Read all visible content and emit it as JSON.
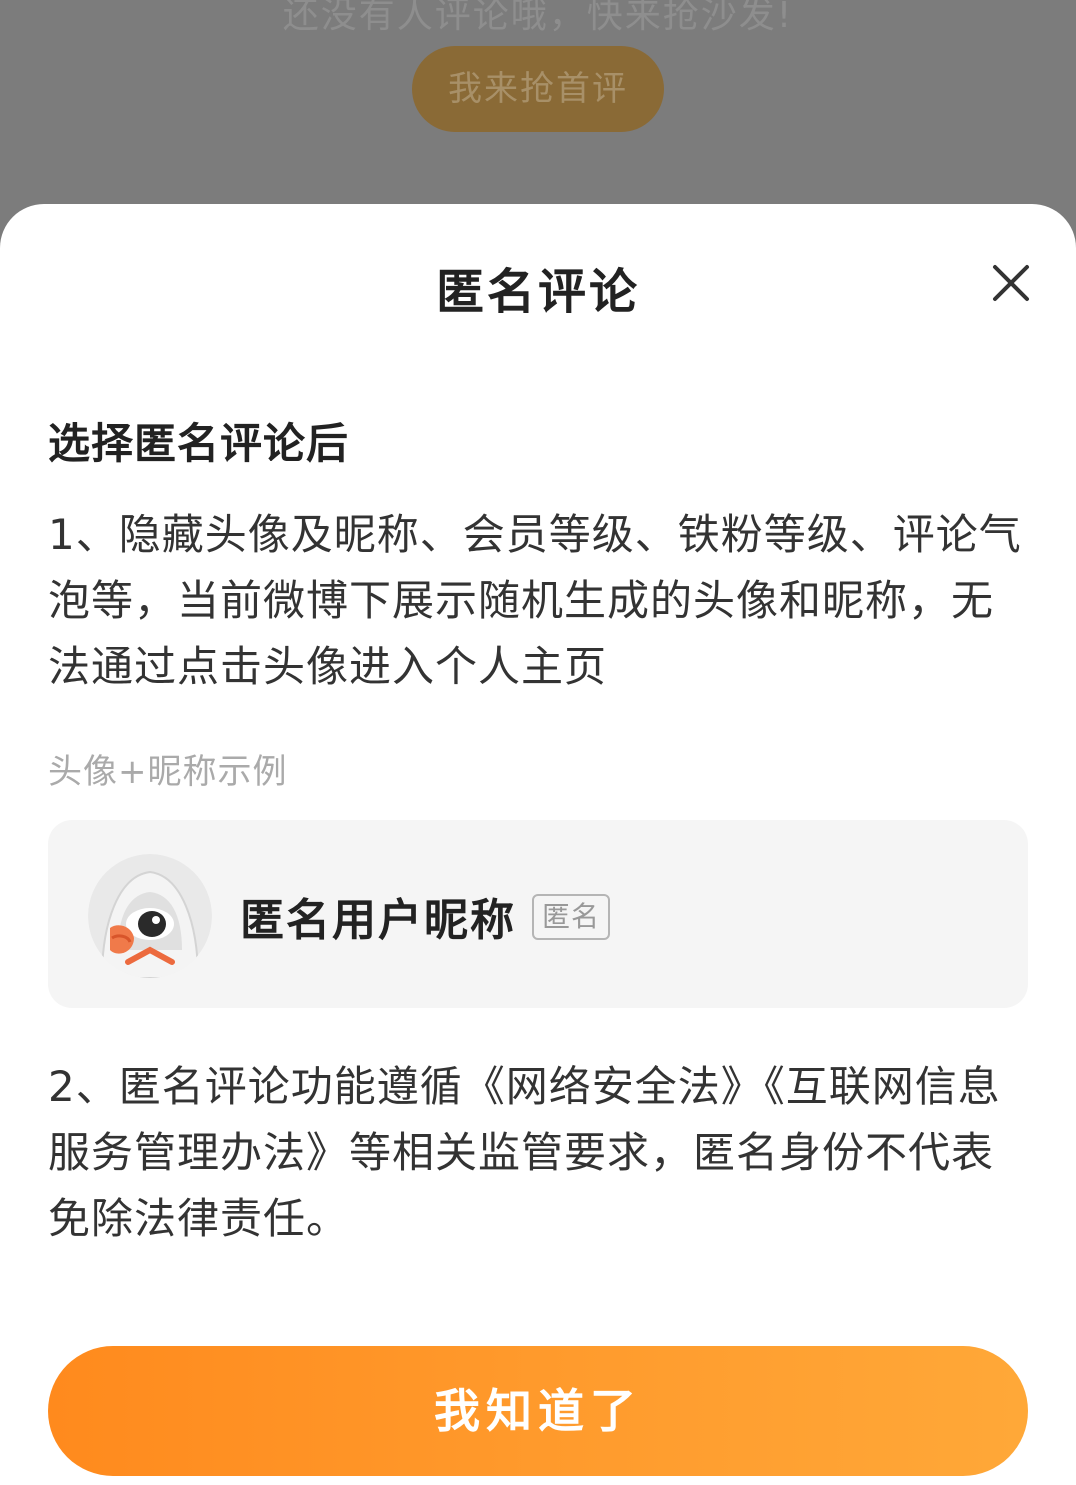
{
  "background": {
    "hint_text": "还没有人评论哦，快来抢沙发!",
    "first_comment_button": "我来抢首评"
  },
  "sheet": {
    "title": "匿名评论",
    "close_icon": "close-icon",
    "heading": "选择匿名评论后",
    "point_1": "1、隐藏头像及昵称、会员等级、铁粉等级、评论气泡等，当前微博下展示随机生成的头像和昵称，无法通过点击头像进入个人主页",
    "example_caption": "头像+昵称示例",
    "example": {
      "avatar_icon": "hooded-anonymous-avatar-icon",
      "nickname": "匿名用户昵称",
      "badge": "匿名"
    },
    "point_2": "2、匿名评论功能遵循《网络安全法》《互联网信息服务管理办法》等相关监管要求，匿名身份不代表免除法律责任。",
    "confirm_button": "我知道了"
  },
  "colors": {
    "accent": "#ff9a2c",
    "backdrop": "#7c7c7c",
    "card": "#f5f5f5"
  }
}
